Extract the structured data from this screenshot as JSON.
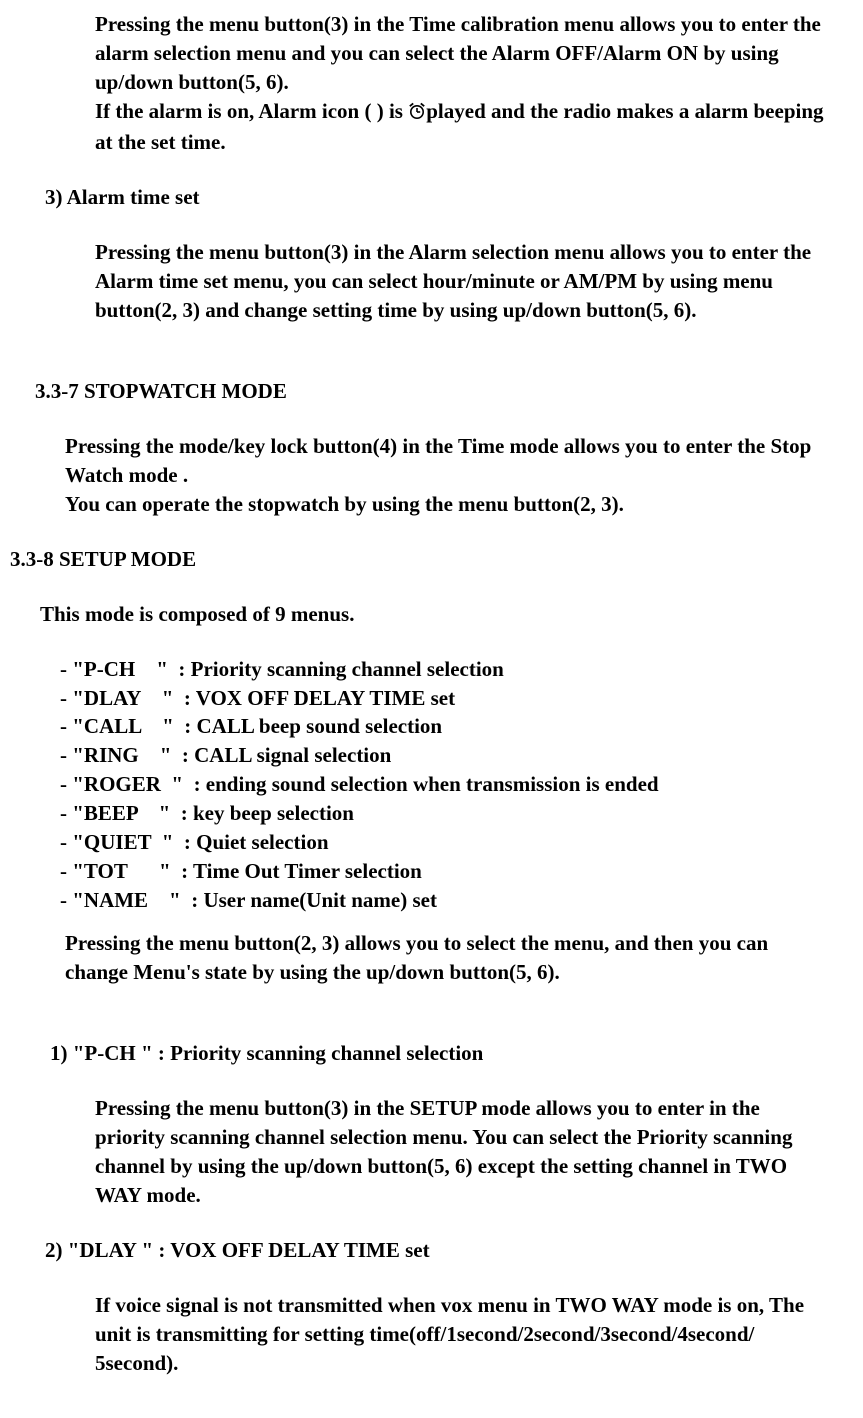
{
  "s_alarm_intro": {
    "p1": "Pressing the menu button(3) in the Time calibration menu allows you to enter the alarm selection menu and you can select the Alarm OFF/Alarm ON by using up/down button(5, 6).",
    "p2a": "If the alarm is on, Alarm icon (     ) is ",
    "p2b": "played and the radio makes a alarm beeping at the set time."
  },
  "s_alarm_time": {
    "heading": "3)  Alarm time set",
    "body": "Pressing the menu button(3) in the Alarm selection menu allows you to enter the Alarm time set menu, you can select hour/minute or AM/PM by using menu button(2, 3) and change setting time by using up/down button(5, 6)."
  },
  "s_stopwatch": {
    "heading": "3.3-7      STOPWATCH MODE",
    "p1": "Pressing the mode/key lock button(4) in the Time mode allows you to enter the Stop Watch mode .",
    "p2": "You can operate the stopwatch by using the menu button(2, 3)."
  },
  "s_setup": {
    "heading": "3.3-8      SETUP MODE",
    "intro": "This mode is composed of 9 menus.",
    "items": [
      {
        "label": "P-CH",
        "pad": "    ",
        "desc": ": Priority scanning channel selection"
      },
      {
        "label": "DLAY",
        "pad": "    ",
        "desc": ": VOX OFF DELAY TIME set"
      },
      {
        "label": "CALL",
        "pad": "    ",
        "desc": ": CALL beep sound selection"
      },
      {
        "label": "RING",
        "pad": "    ",
        "desc": ": CALL signal selection"
      },
      {
        "label": "ROGER",
        "pad": "  ",
        "desc": ": ending sound selection when transmission is ended"
      },
      {
        "label": "BEEP",
        "pad": "    ",
        "desc": ": key beep selection"
      },
      {
        "label": "QUIET",
        "pad": "  ",
        "desc": ": Quiet selection"
      },
      {
        "label": "TOT",
        "pad": "      ",
        "desc": ": Time Out Timer selection"
      },
      {
        "label": "NAME",
        "pad": "    ",
        "desc": ": User name(Unit name) set"
      }
    ],
    "outro": "Pressing the menu button(2, 3) allows you to select the menu, and then you can change Menu's state by using the up/down button(5, 6)."
  },
  "s_pch": {
    "heading": "1) \"P-CH     \"   : Priority scanning channel selection",
    "body": "Pressing the menu button(3) in the SETUP mode allows you to enter in the priority scanning channel selection menu. You can select the Priority scanning channel by using the up/down button(5, 6) except the setting channel in TWO WAY mode."
  },
  "s_dlay": {
    "heading": "2) \"DLAY     \"  : VOX OFF DELAY TIME set",
    "body": "If voice signal is not transmitted when vox menu in TWO WAY mode is on, The unit is transmitting for setting time(off/1second/2second/3second/4second/ 5second)."
  }
}
